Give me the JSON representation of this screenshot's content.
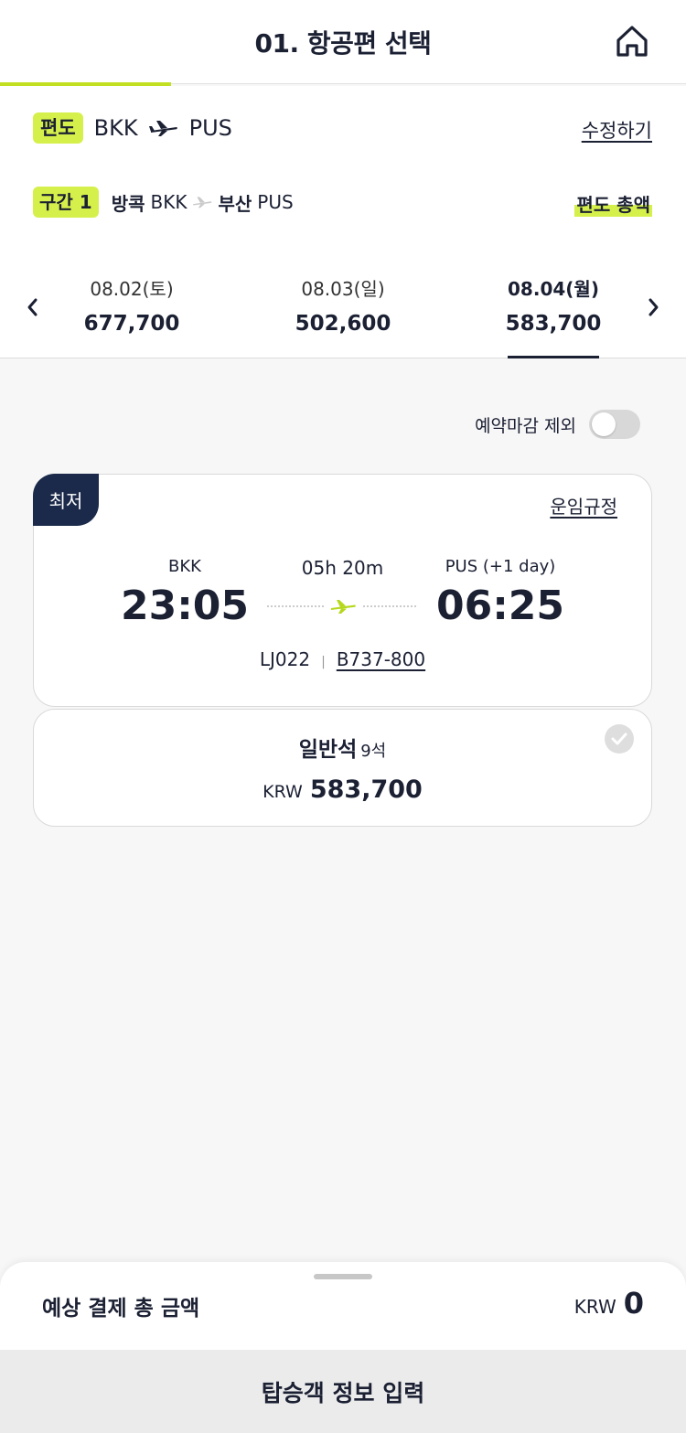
{
  "header": {
    "title": "01. 항공편 선택"
  },
  "trip": {
    "type_badge": "편도",
    "origin": "BKK",
    "destination": "PUS",
    "edit_label": "수정하기"
  },
  "segment": {
    "badge": "구간 1",
    "origin_city": "방콕",
    "origin_code": "BKK",
    "dest_city": "부산",
    "dest_code": "PUS",
    "fare_total_label": "편도 총액"
  },
  "dates": [
    {
      "date": "08.02(토)",
      "price": "677,700",
      "active": false
    },
    {
      "date": "08.03(일)",
      "price": "502,600",
      "active": false
    },
    {
      "date": "08.04(월)",
      "price": "583,700",
      "active": true
    }
  ],
  "filter": {
    "exclude_closed_label": "예약마감 제외",
    "exclude_closed_on": false
  },
  "flight": {
    "badge": "최저",
    "fare_rules_label": "운임규정",
    "dep_code": "BKK",
    "dep_time": "23:05",
    "duration": "05h 20m",
    "arr_code": "PUS (+1 day)",
    "arr_time": "06:25",
    "flight_no": "LJ022",
    "aircraft": "B737-800"
  },
  "seat": {
    "class_name": "일반석",
    "seats_left": "9석",
    "currency": "KRW",
    "price": "583,700"
  },
  "summary": {
    "total_label": "예상 결제 총 금액",
    "currency": "KRW",
    "amount": "0"
  },
  "cta": {
    "label": "탑승객 정보 입력"
  },
  "colors": {
    "accent": "#d6f04b",
    "navy": "#1b2a4a",
    "progress": "#c2e021",
    "plane_green": "#b5d81c"
  }
}
